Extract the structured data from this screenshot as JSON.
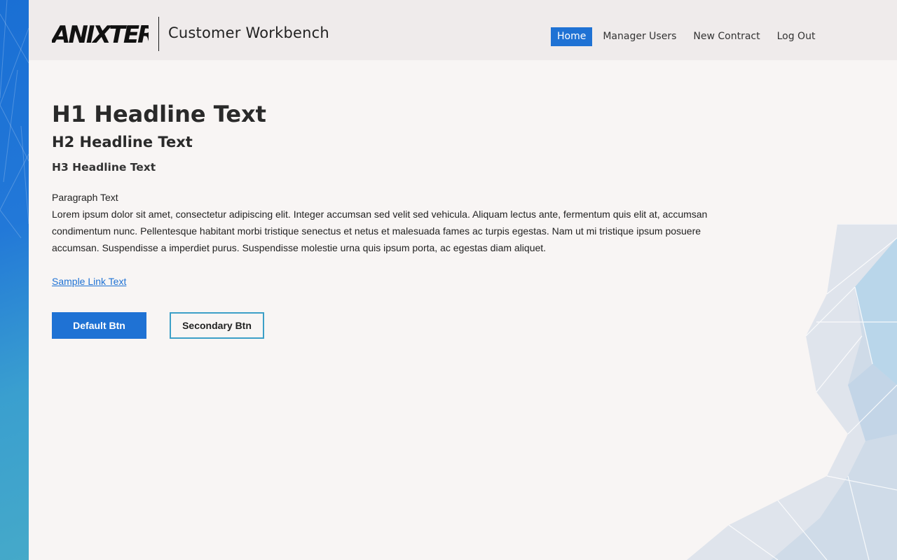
{
  "header": {
    "logo_text": "ANIXTER",
    "app_title": "Customer Workbench",
    "nav": [
      {
        "label": "Home",
        "active": true
      },
      {
        "label": "Manager Users",
        "active": false
      },
      {
        "label": "New Contract",
        "active": false
      },
      {
        "label": "Log Out",
        "active": false
      }
    ]
  },
  "content": {
    "h1": "H1 Headline Text",
    "h2": "H2 Headline Text",
    "h3": "H3 Headline Text",
    "paragraph_label": "Paragraph Text",
    "paragraph": "Lorem ipsum dolor sit amet, consectetur adipiscing elit. Integer accumsan sed velit sed vehicula. Aliquam lectus ante, fermentum quis elit at, accumsan condimentum nunc. Pellentesque habitant morbi tristique senectus et netus et malesuada fames ac turpis egestas. Nam ut mi tristique ipsum posuere accumsan. Suspendisse a imperdiet purus. Suspendisse molestie urna quis ipsum porta, ac egestas diam aliquet.",
    "link": "Sample Link Text",
    "primary_button": "Default Btn",
    "secondary_button": "Secondary Btn"
  },
  "colors": {
    "accent": "#1f72d4",
    "secondary_border": "#3c9fc7",
    "header_bg": "#efebeb",
    "page_bg": "#f8f5f4"
  }
}
